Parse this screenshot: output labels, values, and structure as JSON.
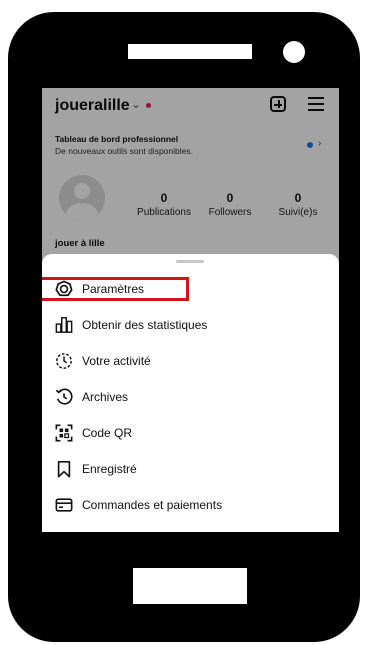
{
  "header": {
    "username": "joueralille",
    "chevron": "⌄"
  },
  "icons": {
    "create": "plus-square-icon",
    "menu": "hamburger-menu-icon"
  },
  "banner": {
    "title": "Tableau de bord professionnel",
    "subtitle": "De nouveaux outils sont disponibles.",
    "arrow": "›"
  },
  "profile": {
    "stats": [
      {
        "value": "0",
        "label": "Publications"
      },
      {
        "value": "0",
        "label": "Followers"
      },
      {
        "value": "0",
        "label": "Suivi(e)s"
      }
    ],
    "name": "jouer à lille"
  },
  "menu": {
    "items": [
      {
        "label": "Paramètres",
        "icon": "gear-icon"
      },
      {
        "label": "Obtenir des statistiques",
        "icon": "bar-chart-icon"
      },
      {
        "label": "Votre activité",
        "icon": "activity-icon"
      },
      {
        "label": "Archives",
        "icon": "archive-history-icon"
      },
      {
        "label": "Code QR",
        "icon": "qr-code-icon"
      },
      {
        "label": "Enregistré",
        "icon": "bookmark-icon"
      },
      {
        "label": "Commandes et paiements",
        "icon": "credit-card-icon"
      }
    ]
  },
  "colors": {
    "highlight": "#d0141e",
    "notification": "#e0245e",
    "accent": "#1877f2"
  }
}
